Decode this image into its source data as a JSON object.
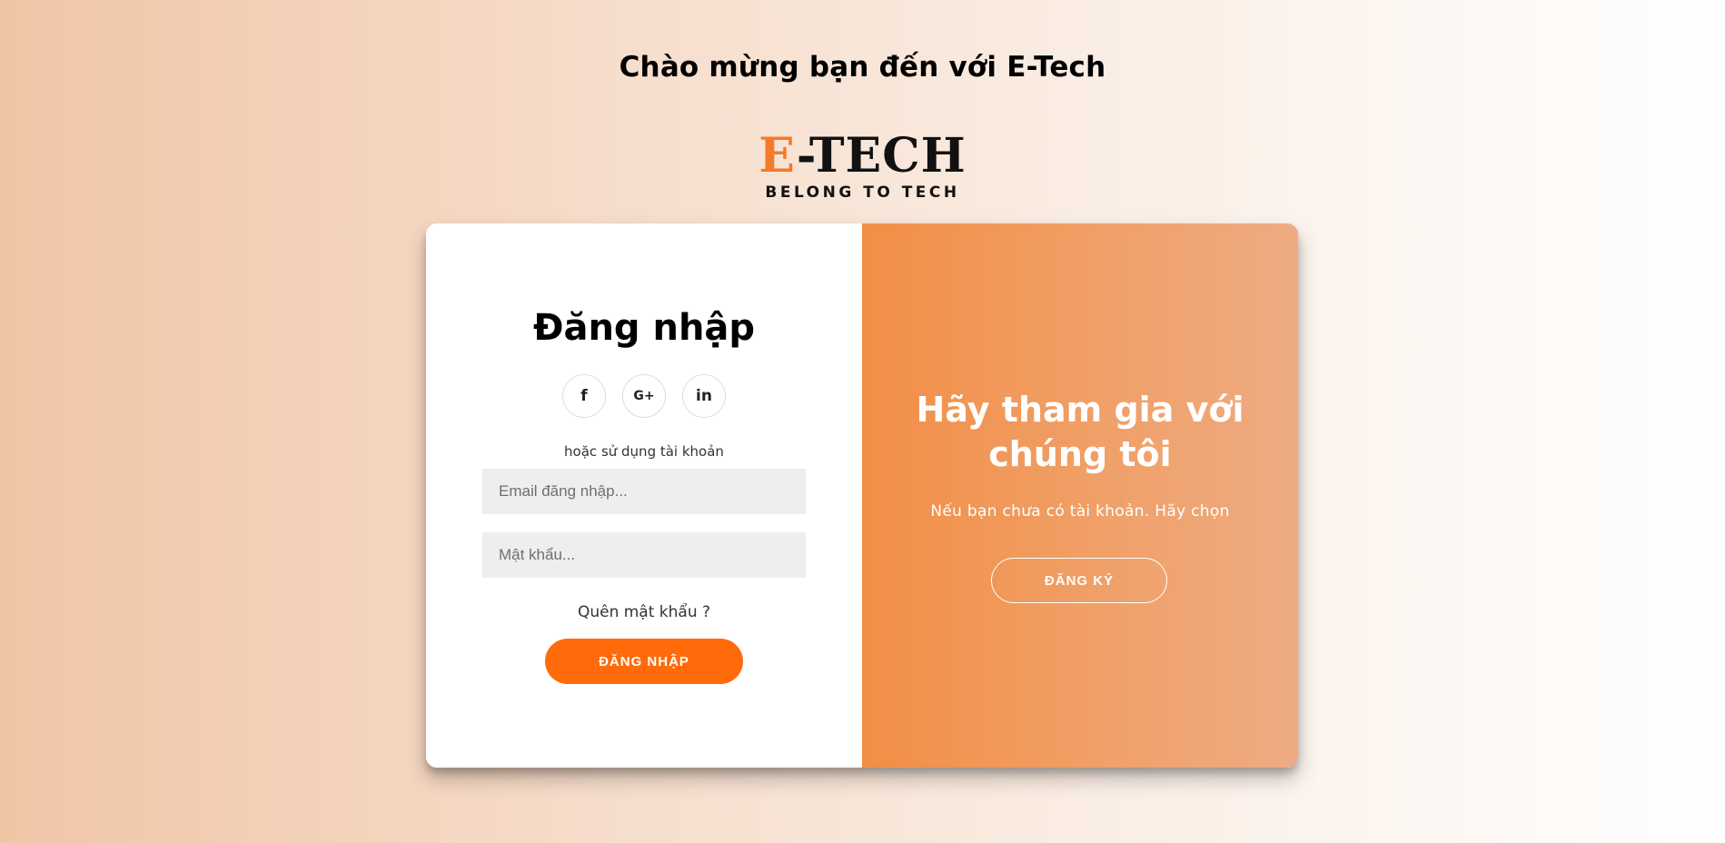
{
  "header": {
    "welcome_title": "Chào mừng bạn đến với E-Tech"
  },
  "logo": {
    "brand_accent": "E",
    "brand_rest": "-TECH",
    "tagline": "BELONG TO TECH",
    "accent_color": "#f47a2a"
  },
  "login": {
    "title": "Đăng nhập",
    "social": [
      {
        "icon": "facebook-icon",
        "glyph": "f"
      },
      {
        "icon": "google-plus-icon",
        "glyph": "G+"
      },
      {
        "icon": "linkedin-icon",
        "glyph": "in"
      }
    ],
    "or_text": "hoặc sử dụng tài khoản",
    "email_placeholder": "Email đăng nhập...",
    "password_placeholder": "Mật khẩu...",
    "forgot_password": "Quên mật khẩu ?",
    "login_button": "ĐĂNG NHẬP",
    "button_color": "#ff6a0a"
  },
  "signup_panel": {
    "title": "Hãy tham gia với chúng tôi",
    "text": "Nếu bạn chưa có tài khoản. Hãy chọn",
    "signup_button": "ĐĂNG KÝ",
    "panel_color": "#f28e46"
  }
}
